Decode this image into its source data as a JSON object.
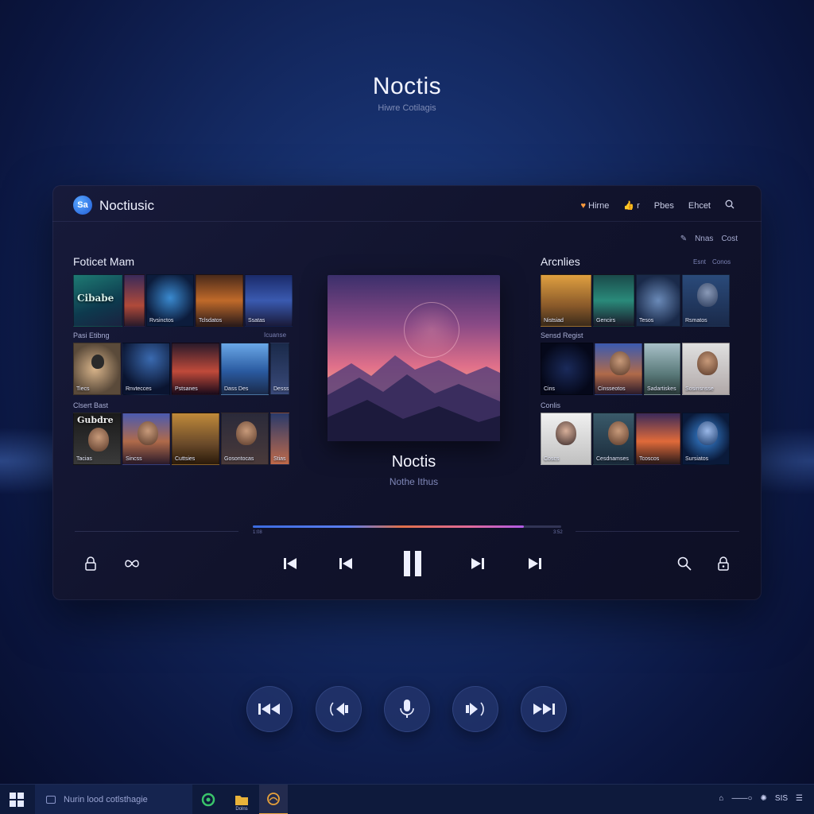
{
  "hero": {
    "title": "Noctis",
    "subtitle": "Hiwre Cotilagis"
  },
  "app": {
    "logo_text": "Sa",
    "name": "Noctiusic",
    "nav": [
      "Hirne",
      "r",
      "Pbes",
      "Ehcet"
    ],
    "sub_actions": [
      "Nnas",
      "Cost"
    ]
  },
  "left": {
    "title": "Foticet Mam",
    "rows": [
      {
        "label": "",
        "link": "",
        "tiles": [
          {
            "big": "Cibabe",
            "caption": ""
          },
          {
            "big": "",
            "caption": ""
          },
          {
            "big": "",
            "caption": "Rvsinctos"
          },
          {
            "big": "",
            "caption": "Tclsdatos"
          },
          {
            "big": "",
            "caption": "Ssatas"
          }
        ]
      },
      {
        "label": "Pasi Etibng",
        "link": "Icuanse",
        "tiles": [
          {
            "big": "",
            "caption": "Tiecs"
          },
          {
            "big": "",
            "caption": "Rnvtecces"
          },
          {
            "big": "",
            "caption": "Pstsanes"
          },
          {
            "big": "",
            "caption": "Dass Des"
          },
          {
            "big": "",
            "caption": "Desss"
          }
        ]
      },
      {
        "label": "Clsert Bast",
        "link": "",
        "tiles": [
          {
            "big": "Gubdre",
            "caption": "Tacias"
          },
          {
            "big": "",
            "caption": "Sincss"
          },
          {
            "big": "",
            "caption": "Cuttsies"
          },
          {
            "big": "",
            "caption": "Gosontocas"
          },
          {
            "big": "",
            "caption": "Stias"
          }
        ]
      }
    ]
  },
  "right": {
    "title": "Arcnlies",
    "links": [
      "Esnt",
      "Conos"
    ],
    "rows": [
      {
        "label": "",
        "tiles": [
          {
            "big": "",
            "caption": "Nistsiad"
          },
          {
            "big": "",
            "caption": "Gencirs"
          },
          {
            "big": "",
            "caption": "Tesos"
          },
          {
            "big": "",
            "caption": "Rsmatos"
          }
        ]
      },
      {
        "label": "Sensd Regist",
        "tiles": [
          {
            "big": "",
            "caption": "Cins"
          },
          {
            "big": "",
            "caption": "Cinsseotos"
          },
          {
            "big": "",
            "caption": "Sadartiskes"
          },
          {
            "big": "",
            "caption": "Sosinsnsse"
          }
        ]
      },
      {
        "label": "Conlis",
        "tiles": [
          {
            "big": "",
            "caption": "Coscs"
          },
          {
            "big": "",
            "caption": "Cesdnamses"
          },
          {
            "big": "",
            "caption": "Tcoscos"
          },
          {
            "big": "",
            "caption": "Sursiatos"
          }
        ]
      }
    ]
  },
  "now_playing": {
    "title": "Noctis",
    "artist": "Nothe Ithus",
    "progress": 0.88,
    "time_elapsed": "1:08",
    "time_total": "3:52"
  },
  "controls": [
    "lock-icon",
    "loop-icon",
    "skip-back-icon",
    "previous-icon",
    "pause-icon",
    "next-icon",
    "skip-forward-icon",
    "search-icon",
    "lock-icon"
  ],
  "round_buttons": [
    "rewind-icon",
    "volume-down-icon",
    "microphone-icon",
    "volume-up-icon",
    "fast-forward-icon"
  ],
  "taskbar": {
    "search_text": "Nurin lood cotlsthagie",
    "apps": [
      {
        "name": "app-green",
        "label": ""
      },
      {
        "name": "app-files",
        "label": "Dolns"
      },
      {
        "name": "app-noctis",
        "label": ""
      }
    ],
    "tray_text": "SIS"
  },
  "colors": {
    "accent_orange": "#ff9a3c",
    "accent_blue": "#3b6be0",
    "accent_purple": "#b05ae6"
  }
}
